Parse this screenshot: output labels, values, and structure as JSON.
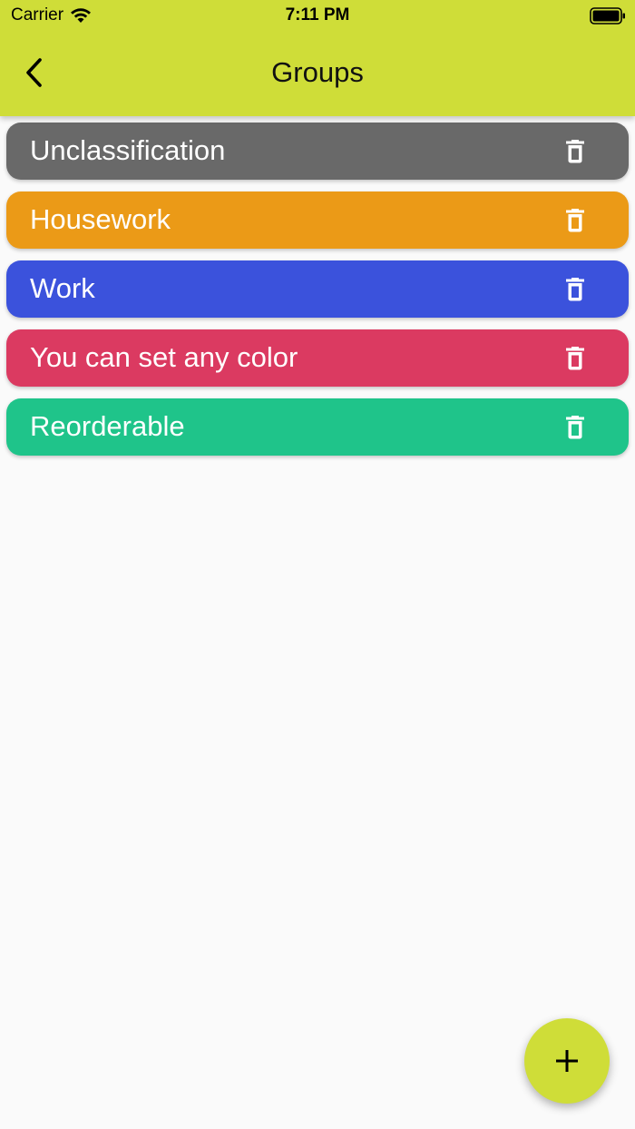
{
  "status_bar": {
    "carrier": "Carrier",
    "time": "7:11 PM",
    "wifi_icon": "wifi-icon",
    "battery_icon": "battery-full-icon"
  },
  "header": {
    "title": "Groups",
    "back_icon": "chevron-left-icon",
    "background_color": "#cfdd38"
  },
  "groups": [
    {
      "label": "Unclassification",
      "color": "#696969",
      "delete_icon": "trash-icon"
    },
    {
      "label": "Housework",
      "color": "#eb9a17",
      "delete_icon": "trash-icon"
    },
    {
      "label": "Work",
      "color": "#3b52dc",
      "delete_icon": "trash-icon"
    },
    {
      "label": "You can set any color",
      "color": "#db3a61",
      "delete_icon": "trash-icon"
    },
    {
      "label": "Reorderable",
      "color": "#1fc48a",
      "delete_icon": "trash-icon"
    }
  ],
  "fab": {
    "icon": "plus-icon",
    "color": "#cfdd38"
  }
}
